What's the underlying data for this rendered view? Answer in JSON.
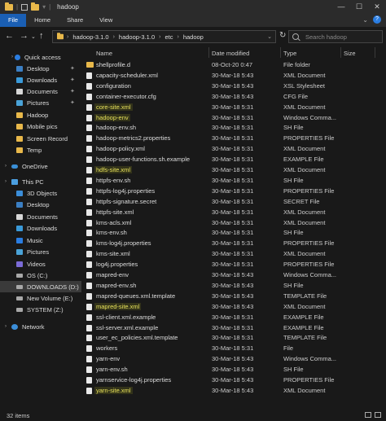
{
  "window": {
    "title": "hadoop",
    "controls": [
      "—",
      "☐",
      "✕"
    ]
  },
  "ribbon": {
    "tabs": [
      "File",
      "Home",
      "Share",
      "View"
    ]
  },
  "nav": {
    "path": [
      "hadoop-3.1.0",
      "hadoop-3.1.0",
      "etc",
      "hadoop"
    ],
    "search_placeholder": "Search hadoop"
  },
  "sidebar": {
    "items": [
      {
        "label": "Quick access",
        "icon": "star-icon"
      },
      {
        "label": "Desktop",
        "icon": "desktop-icon",
        "pinned": true
      },
      {
        "label": "Downloads",
        "icon": "download-icon",
        "pinned": true
      },
      {
        "label": "Documents",
        "icon": "documents-icon",
        "pinned": true
      },
      {
        "label": "Pictures",
        "icon": "pictures-icon",
        "pinned": true
      },
      {
        "label": "Hadoop",
        "icon": "folder-icon"
      },
      {
        "label": "Mobile pics",
        "icon": "folder-icon"
      },
      {
        "label": "Screen Record",
        "icon": "folder-icon"
      },
      {
        "label": "Temp",
        "icon": "folder-icon"
      },
      {
        "label": "OneDrive",
        "icon": "onedrive-icon"
      },
      {
        "label": "This PC",
        "icon": "pc-icon"
      },
      {
        "label": "3D Objects",
        "icon": "3d-objects-icon"
      },
      {
        "label": "Desktop",
        "icon": "desktop-icon"
      },
      {
        "label": "Documents",
        "icon": "documents-icon"
      },
      {
        "label": "Downloads",
        "icon": "download-icon"
      },
      {
        "label": "Music",
        "icon": "music-icon"
      },
      {
        "label": "Pictures",
        "icon": "pictures-icon"
      },
      {
        "label": "Videos",
        "icon": "videos-icon"
      },
      {
        "label": "OS (C:)",
        "icon": "drive-icon"
      },
      {
        "label": "DOWNLOADS (D:)",
        "icon": "drive-icon"
      },
      {
        "label": "New Volume (E:)",
        "icon": "drive-icon"
      },
      {
        "label": "SYSTEM (Z:)",
        "icon": "drive-icon"
      },
      {
        "label": "Network",
        "icon": "network-icon"
      }
    ]
  },
  "columns": {
    "name": "Name",
    "date": "Date modified",
    "type": "Type",
    "size": "Size"
  },
  "files": [
    {
      "name": "shellprofile.d",
      "date": "08-Oct-20 0:47",
      "type": "File folder",
      "size": "",
      "folder": true
    },
    {
      "name": "capacity-scheduler.xml",
      "date": "30-Mar-18 5:43",
      "type": "XML Document",
      "size": ""
    },
    {
      "name": "configuration",
      "date": "30-Mar-18 5:43",
      "type": "XSL Stylesheet",
      "size": ""
    },
    {
      "name": "container-executor.cfg",
      "date": "30-Mar-18 5:43",
      "type": "CFG File",
      "size": ""
    },
    {
      "name": "core-site.xml",
      "date": "30-Mar-18 5:31",
      "type": "XML Document",
      "size": "",
      "highlight": true
    },
    {
      "name": "hadoop-env",
      "date": "30-Mar-18 5:31",
      "type": "Windows Comma...",
      "size": "",
      "highlight": true
    },
    {
      "name": "hadoop-env.sh",
      "date": "30-Mar-18 5:31",
      "type": "SH File",
      "size": ""
    },
    {
      "name": "hadoop-metrics2.properties",
      "date": "30-Mar-18 5:31",
      "type": "PROPERTIES File",
      "size": ""
    },
    {
      "name": "hadoop-policy.xml",
      "date": "30-Mar-18 5:31",
      "type": "XML Document",
      "size": ""
    },
    {
      "name": "hadoop-user-functions.sh.example",
      "date": "30-Mar-18 5:31",
      "type": "EXAMPLE File",
      "size": ""
    },
    {
      "name": "hdfs-site.xml",
      "date": "30-Mar-18 5:31",
      "type": "XML Document",
      "size": "",
      "highlight": true
    },
    {
      "name": "httpfs-env.sh",
      "date": "30-Mar-18 5:31",
      "type": "SH File",
      "size": ""
    },
    {
      "name": "httpfs-log4j.properties",
      "date": "30-Mar-18 5:31",
      "type": "PROPERTIES File",
      "size": ""
    },
    {
      "name": "httpfs-signature.secret",
      "date": "30-Mar-18 5:31",
      "type": "SECRET File",
      "size": ""
    },
    {
      "name": "httpfs-site.xml",
      "date": "30-Mar-18 5:31",
      "type": "XML Document",
      "size": ""
    },
    {
      "name": "kms-acls.xml",
      "date": "30-Mar-18 5:31",
      "type": "XML Document",
      "size": ""
    },
    {
      "name": "kms-env.sh",
      "date": "30-Mar-18 5:31",
      "type": "SH File",
      "size": ""
    },
    {
      "name": "kms-log4j.properties",
      "date": "30-Mar-18 5:31",
      "type": "PROPERTIES File",
      "size": ""
    },
    {
      "name": "kms-site.xml",
      "date": "30-Mar-18 5:31",
      "type": "XML Document",
      "size": ""
    },
    {
      "name": "log4j.properties",
      "date": "30-Mar-18 5:31",
      "type": "PROPERTIES File",
      "size": ""
    },
    {
      "name": "mapred-env",
      "date": "30-Mar-18 5:43",
      "type": "Windows Comma...",
      "size": ""
    },
    {
      "name": "mapred-env.sh",
      "date": "30-Mar-18 5:43",
      "type": "SH File",
      "size": ""
    },
    {
      "name": "mapred-queues.xml.template",
      "date": "30-Mar-18 5:43",
      "type": "TEMPLATE File",
      "size": ""
    },
    {
      "name": "mapred-site.xml",
      "date": "30-Mar-18 5:43",
      "type": "XML Document",
      "size": "",
      "highlight": true
    },
    {
      "name": "ssl-client.xml.example",
      "date": "30-Mar-18 5:31",
      "type": "EXAMPLE File",
      "size": ""
    },
    {
      "name": "ssl-server.xml.example",
      "date": "30-Mar-18 5:31",
      "type": "EXAMPLE File",
      "size": ""
    },
    {
      "name": "user_ec_policies.xml.template",
      "date": "30-Mar-18 5:31",
      "type": "TEMPLATE File",
      "size": ""
    },
    {
      "name": "workers",
      "date": "30-Mar-18 5:31",
      "type": "File",
      "size": ""
    },
    {
      "name": "yarn-env",
      "date": "30-Mar-18 5:43",
      "type": "Windows Comma...",
      "size": ""
    },
    {
      "name": "yarn-env.sh",
      "date": "30-Mar-18 5:43",
      "type": "SH File",
      "size": ""
    },
    {
      "name": "yarnservice-log4j.properties",
      "date": "30-Mar-18 5:43",
      "type": "PROPERTIES File",
      "size": ""
    },
    {
      "name": "yarn-site.xml",
      "date": "30-Mar-18 5:43",
      "type": "XML Document",
      "size": "",
      "highlight": true
    }
  ],
  "status": {
    "count": "32 items"
  },
  "colors": {
    "accent": "#1a5fb4",
    "highlight_text": "#e6e05a",
    "folder": "#e8b84a"
  }
}
